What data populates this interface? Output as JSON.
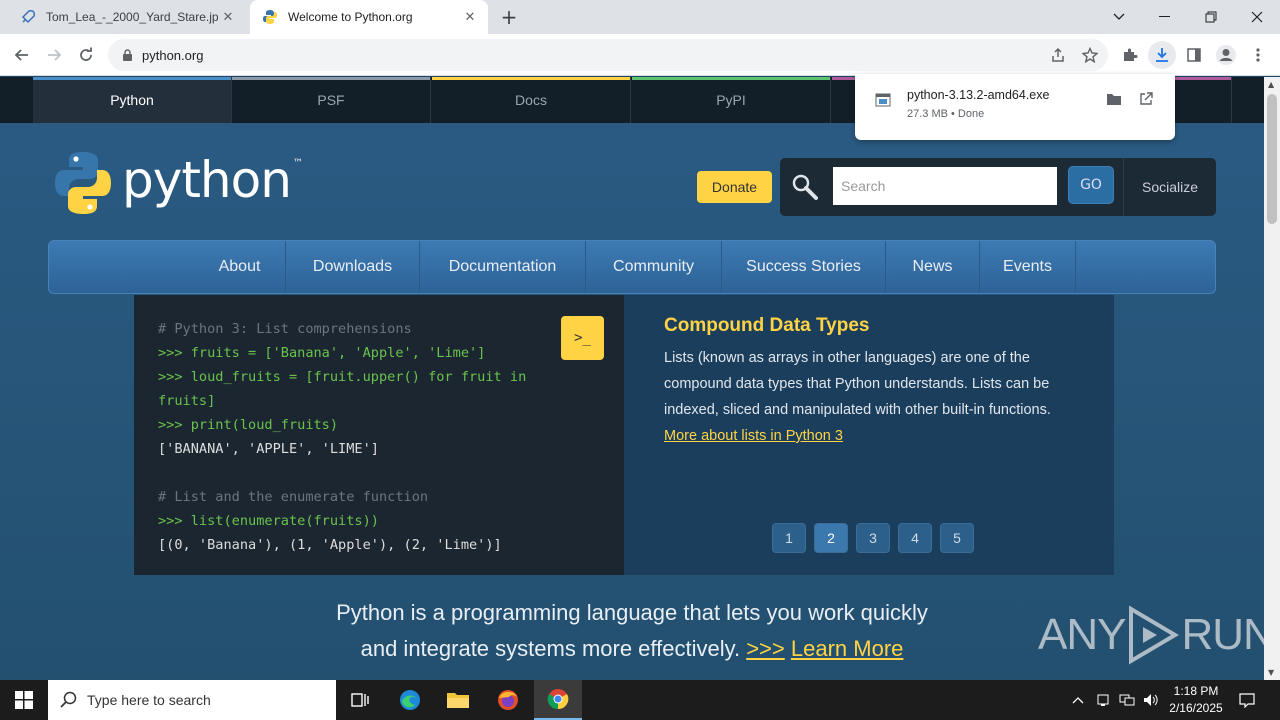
{
  "browser": {
    "tabs": [
      {
        "title": "Tom_Lea_-_2000_Yard_Stare.jpg",
        "active": false
      },
      {
        "title": "Welcome to Python.org",
        "active": true
      }
    ],
    "url": "python.org"
  },
  "download": {
    "filename": "python-3.13.2-amd64.exe",
    "meta": "27.3 MB • Done"
  },
  "site": {
    "meta_nav": [
      "Python",
      "PSF",
      "Docs",
      "PyPI"
    ],
    "meta_nav_colors": [
      "#4a8fc7",
      "#9aa6b0",
      "#ffd343",
      "#5ec46b"
    ],
    "logo_text": "python",
    "logo_tm": "™",
    "donate": "Donate",
    "search_placeholder": "Search",
    "go": "GO",
    "socialize": "Socialize",
    "main_nav": [
      "About",
      "Downloads",
      "Documentation",
      "Community",
      "Success Stories",
      "News",
      "Events"
    ],
    "shell": {
      "launch": ">_",
      "lines": [
        {
          "cls": "c",
          "text": "# Python 3: List comprehensions"
        },
        {
          "cls": "p",
          "text": ">>> fruits = ['Banana', 'Apple', 'Lime']"
        },
        {
          "cls": "p",
          "text": ">>> loud_fruits = [fruit.upper() for fruit in"
        },
        {
          "cls": "p",
          "text": "fruits]"
        },
        {
          "cls": "p",
          "text": ">>> print(loud_fruits)"
        },
        {
          "cls": "o",
          "text": "['BANANA', 'APPLE', 'LIME']"
        },
        {
          "cls": "o",
          "text": ""
        },
        {
          "cls": "c",
          "text": "# List and the enumerate function"
        },
        {
          "cls": "p",
          "text": ">>> list(enumerate(fruits))"
        },
        {
          "cls": "o",
          "text": "[(0, 'Banana'), (1, 'Apple'), (2, 'Lime')]"
        }
      ]
    },
    "feature": {
      "title": "Compound Data Types",
      "body": "Lists (known as arrays in other languages) are one of the compound data types that Python understands. Lists can be indexed, sliced and manipulated with other built-in functions.",
      "link": "More about lists in Python 3",
      "pages": [
        "1",
        "2",
        "3",
        "4",
        "5"
      ],
      "active_page": "2"
    },
    "intro": {
      "line1": "Python is a programming language that lets you work quickly",
      "line2": "and integrate systems more effectively.",
      "arrows": ">>>",
      "learn_more": "Learn More"
    }
  },
  "watermark": {
    "left": "ANY",
    "right": "RUN"
  },
  "taskbar": {
    "search_placeholder": "Type here to search",
    "time": "1:18 PM",
    "date": "2/16/2025"
  }
}
